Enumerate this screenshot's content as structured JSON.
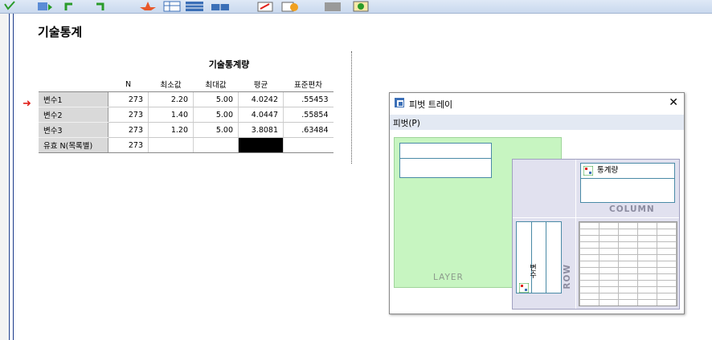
{
  "output": {
    "title": "기술통계",
    "table": {
      "title": "기술통계량",
      "columns": [
        "N",
        "최소값",
        "최대값",
        "평균",
        "표준편차"
      ],
      "rows": [
        {
          "label": "변수1",
          "n": "273",
          "min": "2.20",
          "max": "5.00",
          "mean": "4.0242",
          "sd": ".55453"
        },
        {
          "label": "변수2",
          "n": "273",
          "min": "1.40",
          "max": "5.00",
          "mean": "4.0447",
          "sd": ".55854"
        },
        {
          "label": "변수3",
          "n": "273",
          "min": "1.20",
          "max": "5.00",
          "mean": "3.8081",
          "sd": ".63484"
        },
        {
          "label": "유효 N(목록별)",
          "n": "273",
          "min": "",
          "max": "",
          "mean": "",
          "sd": ""
        }
      ]
    }
  },
  "pivot_tray": {
    "title": "피벗 트레이",
    "close": "✕",
    "menu_label": "피벗(P)",
    "column_chip": "통계량",
    "row_chip": "변수",
    "layer_label": "LAYER",
    "column_label": "COLUMN",
    "row_label": "ROW"
  },
  "icons": [
    "toolbar-icon",
    "arrow-icon",
    "pivot-icon"
  ],
  "colors": {
    "layer_bg": "#c7f5c1",
    "pivot_bg": "#e1e1ef",
    "arrow": "#e0201a",
    "frame": "#1a3a8a"
  }
}
